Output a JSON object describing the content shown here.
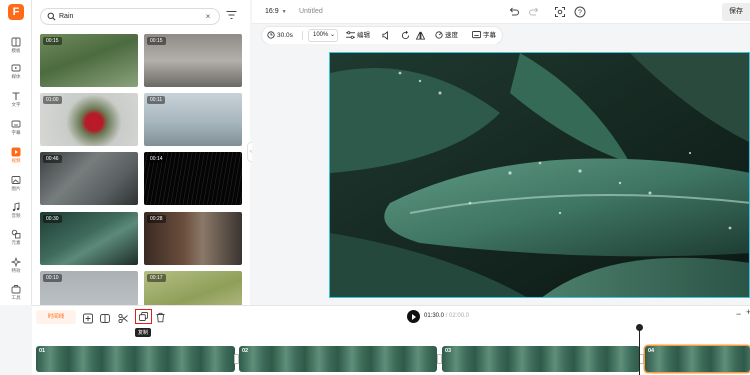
{
  "app": {
    "logo_letter": "F",
    "brand_color": "#ff6a1a"
  },
  "rail": {
    "items": [
      {
        "label": "模板",
        "icon": "template-icon"
      },
      {
        "label": "媒体",
        "icon": "media-icon"
      },
      {
        "label": "文字",
        "icon": "text-icon"
      },
      {
        "label": "字幕",
        "icon": "subtitle-icon"
      },
      {
        "label": "视频",
        "icon": "video-icon"
      },
      {
        "label": "图片",
        "icon": "image-icon"
      },
      {
        "label": "音频",
        "icon": "audio-icon"
      },
      {
        "label": "元素",
        "icon": "elements-icon"
      },
      {
        "label": "特效",
        "icon": "effects-icon"
      },
      {
        "label": "工具",
        "icon": "tools-icon"
      }
    ],
    "active_index": 4
  },
  "panel": {
    "search_value": "Rain",
    "clear_glyph": "×",
    "thumbs": [
      {
        "duration": "00:15"
      },
      {
        "duration": "00:15"
      },
      {
        "duration": "01:00"
      },
      {
        "duration": "00:11"
      },
      {
        "duration": "00:46"
      },
      {
        "duration": "00:14"
      },
      {
        "duration": "00:30"
      },
      {
        "duration": "00:28"
      },
      {
        "duration": "00:10"
      },
      {
        "duration": "00:17"
      }
    ]
  },
  "topbar": {
    "aspect_ratio": "16:9",
    "project_title": "Untitled",
    "save_label": "保存"
  },
  "toolbar": {
    "duration": "30.0s",
    "zoom": "100%",
    "edit_label": "编辑",
    "speed_label": "速度",
    "subtitle_label": "字幕"
  },
  "timeline": {
    "mode_label": "时间线",
    "copy_tooltip": "复制",
    "current_time": "01:30.0",
    "total_time": "/ 02:00.0",
    "clips": [
      {
        "num": "01"
      },
      {
        "num": "02"
      },
      {
        "num": "03"
      },
      {
        "num": "04"
      }
    ]
  }
}
